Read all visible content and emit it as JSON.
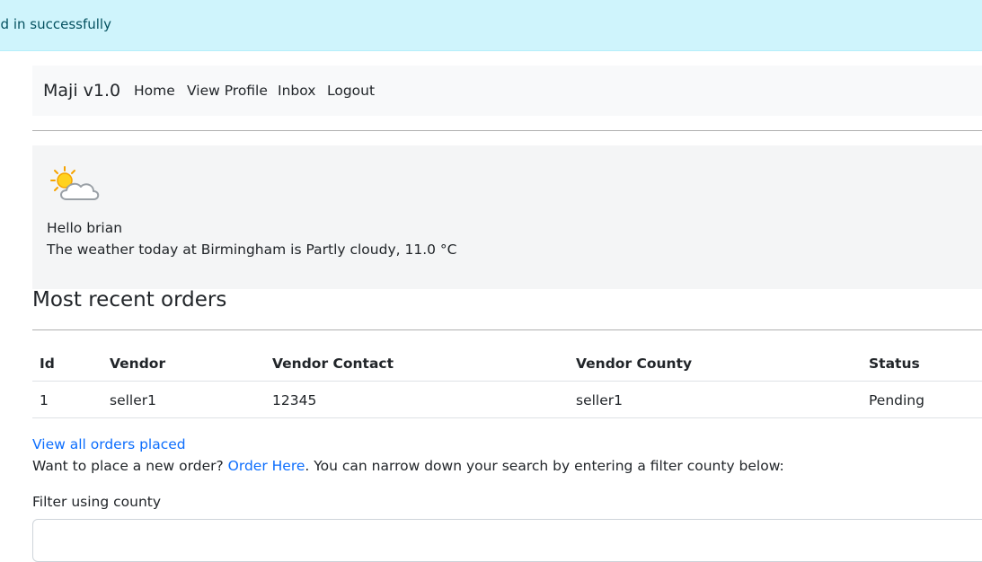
{
  "alert": {
    "message": "Logged in successfully"
  },
  "navbar": {
    "brand": "Maji v1.0",
    "links": [
      {
        "label": "Home"
      },
      {
        "label": "View Profile"
      },
      {
        "label": "Inbox"
      },
      {
        "label": "Logout"
      }
    ]
  },
  "welcome": {
    "weather_icon": "partly-cloudy-icon",
    "greeting": "Hello brian",
    "weather_text": "The weather today at Birmingham is Partly cloudy, 11.0 °C"
  },
  "orders": {
    "title": "Most recent orders",
    "columns": [
      "Id",
      "Vendor",
      "Vendor Contact",
      "Vendor County",
      "Status"
    ],
    "rows": [
      [
        "1",
        "seller1",
        "12345",
        "seller1",
        "Pending"
      ]
    ]
  },
  "actions": {
    "view_all": "View all orders placed",
    "order_prefix": "Want to place a new order? ",
    "order_link": "Order Here",
    "order_suffix": ". You can narrow down your search by entering a filter county below:"
  },
  "filter": {
    "label": "Filter using county",
    "value": "",
    "placeholder": ""
  },
  "colors": {
    "alert_bg": "#cff4fc",
    "alert_text": "#055160",
    "link": "#0d6efd",
    "navbar_bg": "#f8f9fa"
  }
}
